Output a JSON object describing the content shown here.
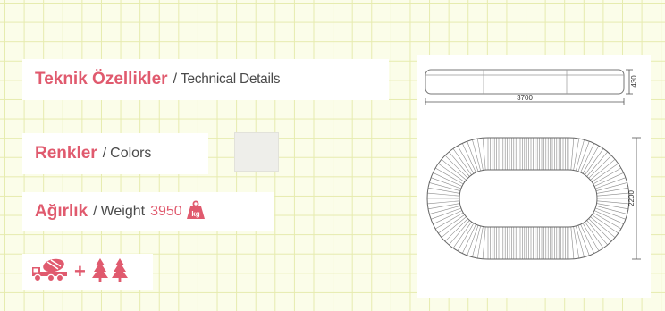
{
  "technical": {
    "title_tr": "Teknik Özellikler",
    "separator": "/",
    "title_en": "Technical Details"
  },
  "colors": {
    "title_tr": "Renkler",
    "separator": "/",
    "title_en": "Colors",
    "swatch_color": "#eeeeea"
  },
  "weight": {
    "title_tr": "Ağırlık",
    "separator": "/",
    "title_en": "Weight",
    "value": "3950",
    "unit_badge": "kg"
  },
  "install_icons": {
    "plus": "+",
    "icons": [
      "concrete-mixer-truck-icon",
      "pine-tree-icon",
      "pine-tree-icon"
    ]
  },
  "drawing": {
    "length_label": "3700",
    "height_label": "430",
    "width_label": "2200"
  },
  "palette": {
    "accent": "#e05a6e",
    "text": "#4a4a4a",
    "background": "#fbfde9",
    "grid": "#e6ebae"
  }
}
